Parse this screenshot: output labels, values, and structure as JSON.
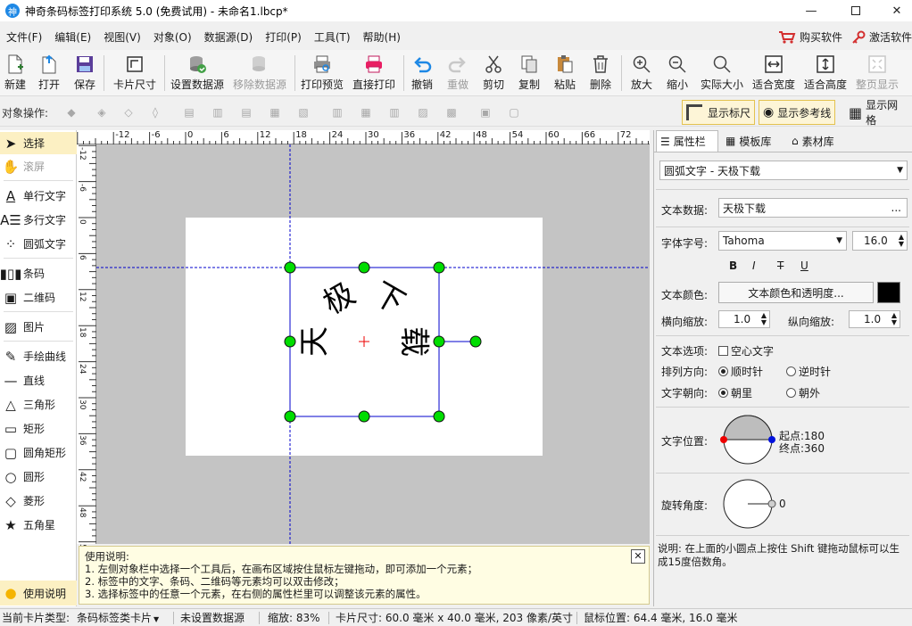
{
  "window": {
    "title": "神奇条码标签打印系统 5.0 (免费试用) - 未命名1.lbcp*",
    "app_icon": "神"
  },
  "menu": {
    "items": [
      "文件(F)",
      "编辑(E)",
      "视图(V)",
      "对象(O)",
      "数据源(D)",
      "打印(P)",
      "工具(T)",
      "帮助(H)"
    ],
    "buy": "购买软件",
    "activate": "激活软件"
  },
  "toolbar": {
    "new": "新建",
    "open": "打开",
    "save": "保存",
    "card_size": "卡片尺寸",
    "set_datasource": "设置数据源",
    "remove_datasource": "移除数据源",
    "print_preview": "打印预览",
    "direct_print": "直接打印",
    "undo": "撤销",
    "redo": "重做",
    "cut": "剪切",
    "copy": "复制",
    "paste": "粘贴",
    "delete": "删除",
    "zoom_in": "放大",
    "zoom_out": "缩小",
    "actual_size": "实际大小",
    "fit_width": "适合宽度",
    "fit_height": "适合高度",
    "full_page": "整页显示"
  },
  "objbar": {
    "label": "对象操作:",
    "show_ruler": "显示标尺",
    "show_guides": "显示参考线",
    "show_grid": "显示网格"
  },
  "tools": {
    "select": "选择",
    "scroll": "滚屏",
    "single_text": "单行文字",
    "multi_text": "多行文字",
    "arc_text": "圆弧文字",
    "barcode": "条码",
    "qrcode": "二维码",
    "image": "图片",
    "freehand": "手绘曲线",
    "line": "直线",
    "triangle": "三角形",
    "rect": "矩形",
    "round_rect": "圆角矩形",
    "circle": "圆形",
    "diamond": "菱形",
    "star": "五角星",
    "help": "使用说明"
  },
  "ruler": {
    "top": [
      "-12",
      "-6",
      "0",
      "6",
      "12",
      "18",
      "24",
      "30",
      "36",
      "42",
      "48",
      "54",
      "60",
      "66",
      "72"
    ],
    "left": [
      "-12",
      "-6",
      "0",
      "6",
      "12",
      "18",
      "24",
      "30",
      "36",
      "42",
      "48",
      "54"
    ]
  },
  "canvas": {
    "arc_chars": [
      "天",
      "极",
      "下",
      "载"
    ]
  },
  "help": {
    "title": "使用说明:",
    "lines": [
      "1. 左侧对象栏中选择一个工具后，在画布区域按住鼠标左键拖动，即可添加一个元素；",
      "2. 标签中的文字、条码、二维码等元素均可以双击修改；",
      "3. 选择标签中的任意一个元素，在右侧的属性栏里可以调整该元素的属性。"
    ],
    "close": "✕"
  },
  "panel": {
    "tabs": [
      "属性栏",
      "模板库",
      "素材库"
    ],
    "object_select": "圆弧文字 - 天极下载",
    "text_data_label": "文本数据:",
    "text_data_value": "天极下载",
    "text_data_more": "...",
    "font_label": "字体字号:",
    "font_name": "Tahoma",
    "font_size": "16.0",
    "style_buttons": [
      "B",
      "I",
      "T",
      "U"
    ],
    "color_label": "文本颜色:",
    "color_button": "文本颜色和透明度...",
    "text_color": "#000000",
    "hscale_label": "横向缩放:",
    "hscale_value": "1.0",
    "vscale_label": "纵向缩放:",
    "vscale_value": "1.0",
    "options_label": "文本选项:",
    "hollow": "空心文字",
    "direction_label": "排列方向:",
    "clockwise": "顺时针",
    "counterclockwise": "逆时针",
    "facing_label": "文字朝向:",
    "inward": "朝里",
    "outward": "朝外",
    "position_label": "文字位置:",
    "start_label": "起点:180",
    "end_label": "终点:360",
    "start_angle": 180,
    "end_angle": 360,
    "rotation_label": "旋转角度:",
    "rotation_value": "0",
    "note": "说明: 在上面的小圆点上按住 Shift 键拖动鼠标可以生成15度倍数角。"
  },
  "status": {
    "card_type_label": "当前卡片类型:",
    "card_type": "条码标签类卡片",
    "datasource": "未设置数据源",
    "zoom": "缩放: 83%",
    "card_size": "卡片尺寸: 60.0 毫米 x 40.0 毫米, 203 像素/英寸",
    "mouse_pos": "鼠标位置: 64.4 毫米, 16.0 毫米"
  },
  "colors": {
    "accent": "#1e88e5",
    "handle": "#00dd00",
    "guide": "#0000cc",
    "selection_bg": "#fcf0c3"
  }
}
